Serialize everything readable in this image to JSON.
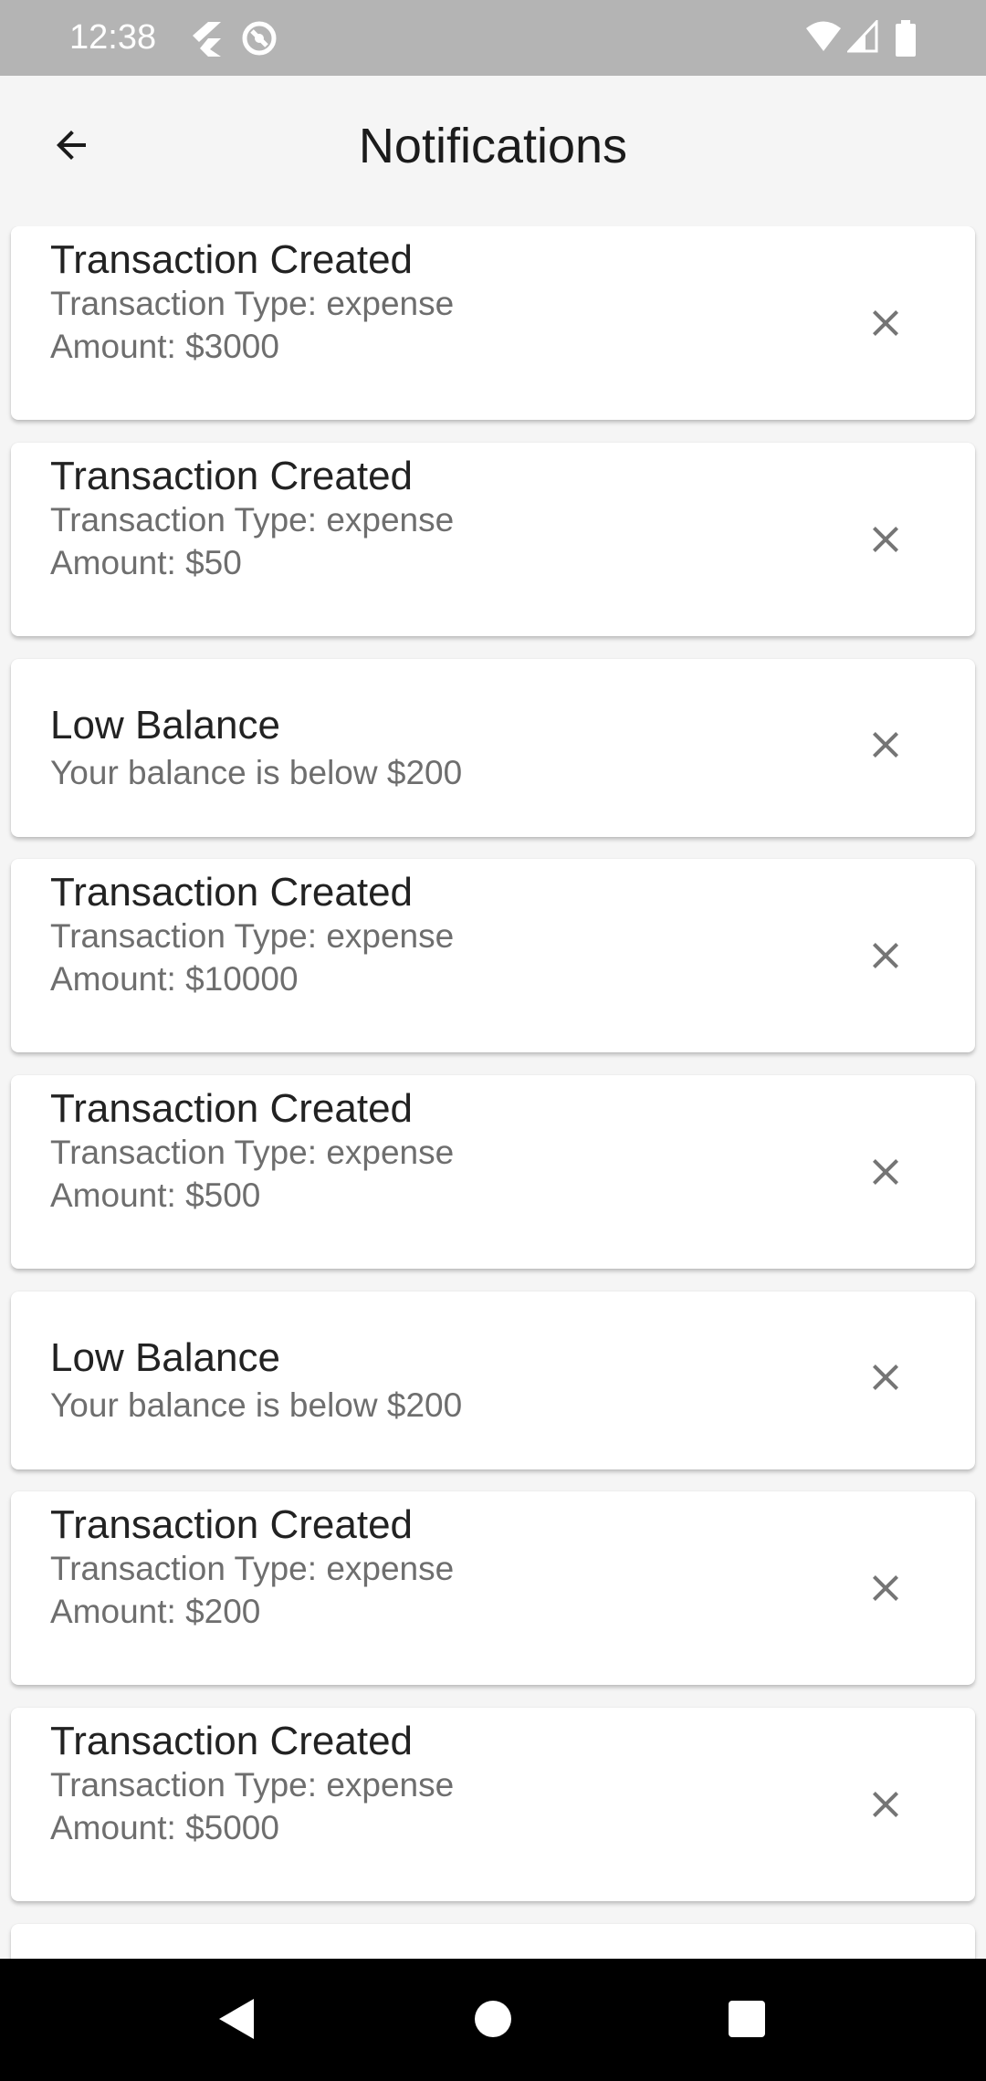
{
  "status_bar": {
    "time": "12:38",
    "left_icons": [
      "flutter-icon",
      "sync-icon"
    ],
    "right_icons": [
      "wifi-icon",
      "signal-icon",
      "battery-icon"
    ]
  },
  "app_bar": {
    "title": "Notifications",
    "back_icon": "arrow-back-icon"
  },
  "notifications": [
    {
      "title": "Transaction Created",
      "lines": [
        "Transaction Type: expense",
        "Amount: $3000"
      ]
    },
    {
      "title": "Transaction Created",
      "lines": [
        "Transaction Type: expense",
        "Amount: $50"
      ]
    },
    {
      "title": "Low Balance",
      "lines": [
        "Your balance is below $200"
      ]
    },
    {
      "title": "Transaction Created",
      "lines": [
        "Transaction Type: expense",
        "Amount: $10000"
      ]
    },
    {
      "title": "Transaction Created",
      "lines": [
        "Transaction Type: expense",
        "Amount: $500"
      ]
    },
    {
      "title": "Low Balance",
      "lines": [
        "Your balance is below $200"
      ]
    },
    {
      "title": "Transaction Created",
      "lines": [
        "Transaction Type: expense",
        "Amount: $200"
      ]
    },
    {
      "title": "Transaction Created",
      "lines": [
        "Transaction Type: expense",
        "Amount: $5000"
      ]
    }
  ],
  "dismiss_icon": "close-icon",
  "nav_bar": [
    "back-triangle-icon",
    "home-circle-icon",
    "recents-square-icon"
  ],
  "colors": {
    "status_bar": "#b4b4b4",
    "background": "#f5f5f5",
    "card": "#ffffff",
    "title_text": "#222222",
    "secondary_text": "#6e6e6e",
    "icon": "#757575",
    "nav_bar": "#000000"
  }
}
